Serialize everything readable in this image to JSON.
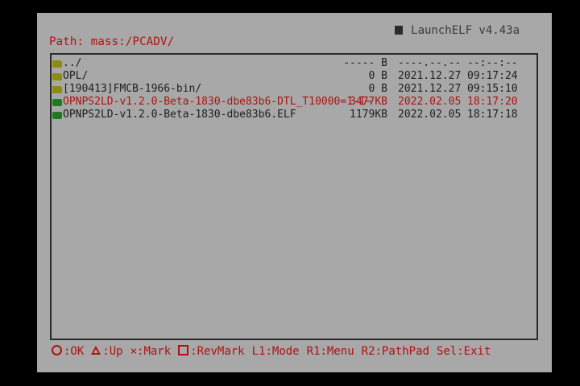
{
  "header": {
    "path": "Path: mass:/PCADV/",
    "app_title": "LaunchELF v4.43a"
  },
  "files": [
    {
      "name": "../",
      "type": "folder",
      "size": "----- B",
      "date": "----.--.--",
      "time": "--:--:--",
      "selected": false
    },
    {
      "name": "OPL/",
      "type": "folder",
      "size": "0 B",
      "date": "2021.12.27",
      "time": "09:17:24",
      "selected": false
    },
    {
      "name": "[190413]FMCB-1966-bin/",
      "type": "folder",
      "size": "0 B",
      "date": "2021.12.27",
      "time": "09:15:10",
      "selected": false
    },
    {
      "name": "OPNPS2LD-v1.2.0-Beta-1830-dbe83b6-DTL_T10000=1-I~",
      "type": "file",
      "size": "3477KB",
      "date": "2022.02.05",
      "time": "18:17:20",
      "selected": true
    },
    {
      "name": "OPNPS2LD-v1.2.0-Beta-1830-dbe83b6.ELF",
      "type": "file",
      "size": "1179KB",
      "date": "2022.02.05",
      "time": "18:17:18",
      "selected": false
    }
  ],
  "footer": {
    "ok_label": ":OK",
    "up_label": ":Up",
    "mark_label": "×:Mark",
    "revmark_label": ":RevMark",
    "l1_label": "L1:Mode",
    "r1_label": "R1:Menu",
    "r2_label": "R2:PathPad",
    "sel_label": "Sel:Exit"
  },
  "colors": {
    "screen_bg": "#a8a8a8",
    "accent_red": "#b01010",
    "folder_icon": "#8c8c14",
    "file_icon": "#1f7a22"
  }
}
